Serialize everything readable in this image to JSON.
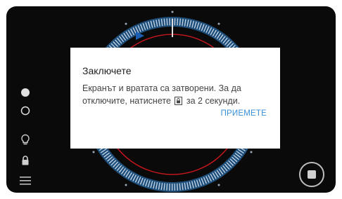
{
  "colors": {
    "screen_bg": "#0a0a0a",
    "dial_ring": "#1e4e7a",
    "dial_ticks": "#c8d8e8",
    "accent_red": "#c0161c",
    "accept_link": "#3a8fd6"
  },
  "sidebar": {
    "icons": [
      "circle-filled-icon",
      "circle-outline-icon",
      "lightbulb-icon",
      "lock-icon",
      "menu-icon"
    ]
  },
  "dialog": {
    "title": "Заключете",
    "text_before_icon": "Екранът и вратата са затворени. За да отключите, натиснете",
    "inline_icon": "lock-icon",
    "text_after_icon": "за 2 секунди.",
    "accept_label": "ПРИЕМЕТЕ"
  },
  "controls": {
    "stop_icon": "stop-icon"
  }
}
